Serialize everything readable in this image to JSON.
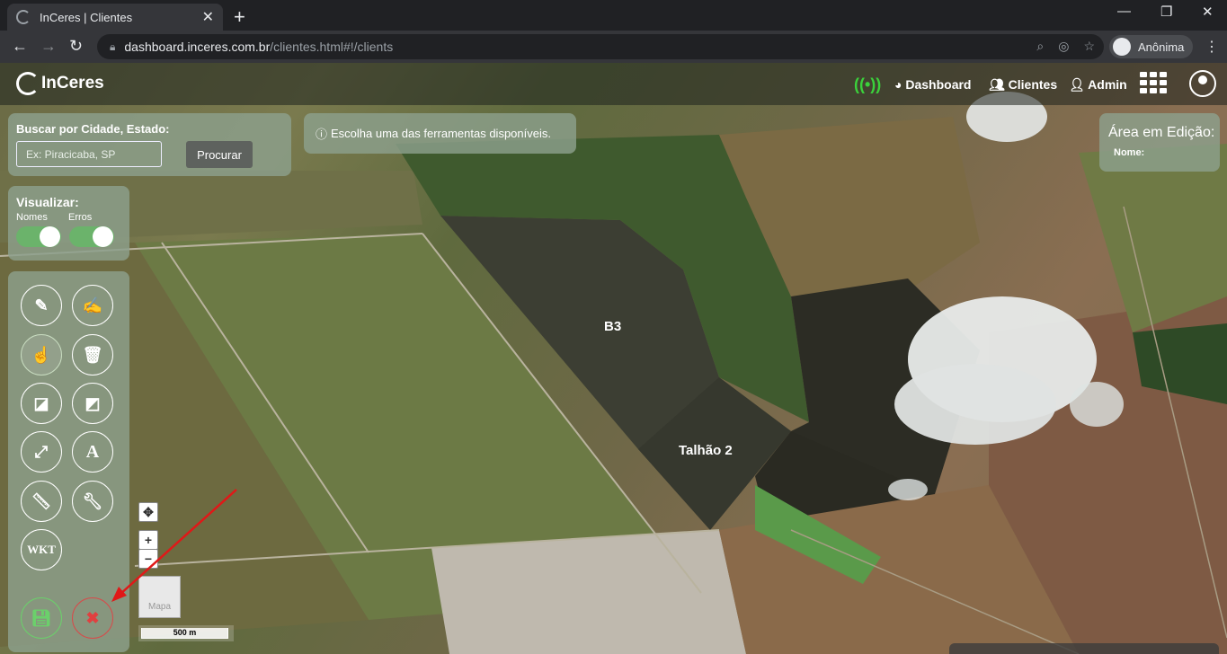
{
  "browser": {
    "tab_title": "InCeres | Clientes",
    "tab_close": "✕",
    "new_tab": "+",
    "url_host": "dashboard.inceres.com.br",
    "url_path": "/clientes.html#!/clients",
    "profile_label": "Anônima"
  },
  "header": {
    "logo_text": "InCeres",
    "nav": [
      {
        "label": "Dashboard",
        "icon": "dashboard-icon"
      },
      {
        "label": "Clientes",
        "icon": "users-icon"
      },
      {
        "label": "Admin",
        "icon": "user-plus-icon"
      }
    ],
    "status_color": "#3bd13b"
  },
  "search": {
    "label": "Buscar por Cidade, Estado:",
    "placeholder": "Ex: Piracicaba, SP",
    "button": "Procurar"
  },
  "info": {
    "message": "Escolha uma das ferramentas disponíveis."
  },
  "edit_area": {
    "title": "Área em Edição:",
    "name_label": "Nome:"
  },
  "view": {
    "title": "Visualizar:",
    "toggles": [
      {
        "label": "Nomes",
        "on": true
      },
      {
        "label": "Erros",
        "on": true
      }
    ]
  },
  "tools": [
    {
      "name": "pencil-icon"
    },
    {
      "name": "edit-icon"
    },
    {
      "name": "hand-stamp-icon",
      "active": true
    },
    {
      "name": "trash-icon"
    },
    {
      "name": "polygon-add-icon"
    },
    {
      "name": "polygon-icon"
    },
    {
      "name": "expand-icon"
    },
    {
      "name": "text-icon",
      "label": "A"
    },
    {
      "name": "ruler-icon"
    },
    {
      "name": "wrench-icon"
    },
    {
      "name": "wkt-icon",
      "label": "WKT"
    }
  ],
  "actions": {
    "save_icon": "save-icon",
    "cancel_icon": "cancel-icon"
  },
  "map": {
    "minimap_label": "Mapa",
    "scale_label": "500 m",
    "plots": [
      "B3",
      "Talhão 2"
    ]
  }
}
